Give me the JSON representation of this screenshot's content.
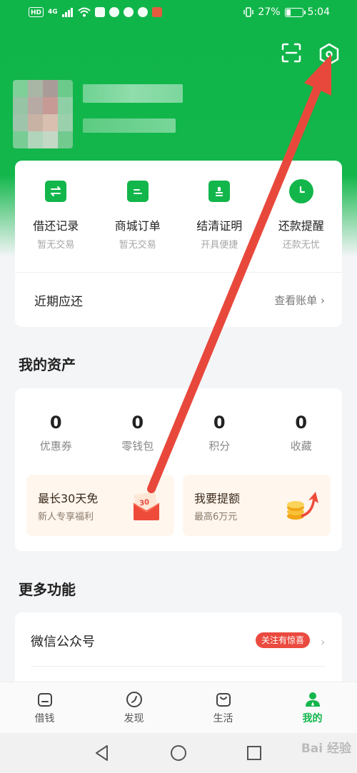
{
  "status_bar": {
    "network": "HD",
    "signal": "4G",
    "battery_percent": "27%",
    "battery_level": 0.27,
    "time": "5:04"
  },
  "header": {
    "icons": [
      "scan-icon",
      "settings-icon"
    ]
  },
  "quick_actions": [
    {
      "label": "借还记录",
      "sub": "暂无交易",
      "icon": "swap-icon"
    },
    {
      "label": "商城订单",
      "sub": "暂无交易",
      "icon": "order-icon"
    },
    {
      "label": "结清证明",
      "sub": "开具便捷",
      "icon": "certificate-icon"
    },
    {
      "label": "还款提醒",
      "sub": "还款无忧",
      "icon": "clock-icon"
    }
  ],
  "recent": {
    "label": "近期应还",
    "link": "查看账单",
    "arrow": "›"
  },
  "assets": {
    "title": "我的资产",
    "stats": [
      {
        "value": "0",
        "label": "优惠券"
      },
      {
        "value": "0",
        "label": "零钱包"
      },
      {
        "value": "0",
        "label": "积分"
      },
      {
        "value": "0",
        "label": "收藏"
      }
    ],
    "promos": [
      {
        "title": "最长30天免",
        "sub": "新人专享福利",
        "icon": "coupon-envelope-icon",
        "icon_text": "30"
      },
      {
        "title": "我要提额",
        "sub": "最高6万元",
        "icon": "coins-arrow-icon"
      }
    ]
  },
  "more": {
    "title": "更多功能",
    "item_label": "微信公众号",
    "badge": "关注有惊喜",
    "arrow": "›"
  },
  "bottom_nav": [
    {
      "label": "借钱",
      "icon": "loan-icon",
      "active": false
    },
    {
      "label": "发现",
      "icon": "compass-icon",
      "active": false
    },
    {
      "label": "生活",
      "icon": "bag-icon",
      "active": false
    },
    {
      "label": "我的",
      "icon": "user-icon",
      "active": true
    }
  ],
  "watermark": "Bai 经验",
  "colors": {
    "brand_green": "#12b64b",
    "annotation_red": "#e8483c",
    "badge_red": "#ea4a3f"
  }
}
